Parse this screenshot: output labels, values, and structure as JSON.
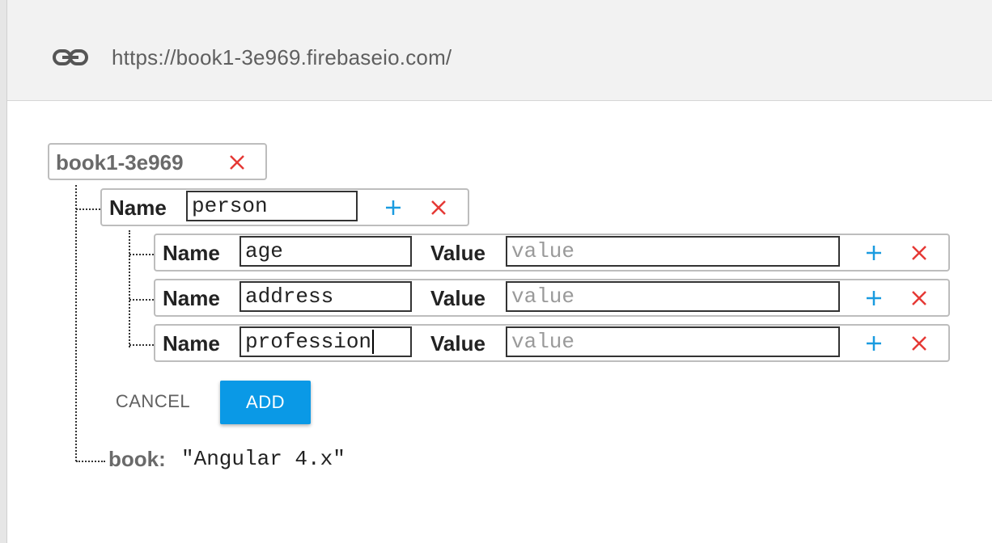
{
  "url_bar": {
    "url": "https://book1-3e969.firebaseio.com/",
    "icon": "link-icon"
  },
  "root": {
    "key": "book1-3e969"
  },
  "new_node": {
    "name_label": "Name",
    "name_value": "person",
    "children": [
      {
        "name_label": "Name",
        "name_value": "age",
        "value_label": "Value",
        "value_placeholder": "value"
      },
      {
        "name_label": "Name",
        "name_value": "address",
        "value_label": "Value",
        "value_placeholder": "value"
      },
      {
        "name_label": "Name",
        "name_value": "profession",
        "value_label": "Value",
        "value_placeholder": "value"
      }
    ]
  },
  "actions": {
    "cancel_label": "CANCEL",
    "add_label": "ADD"
  },
  "existing_child": {
    "key": "book:",
    "value": "\"Angular 4.x\""
  },
  "colors": {
    "accent": "#0a99e6",
    "delete": "#e53935",
    "add_icon": "#1a9be0"
  }
}
